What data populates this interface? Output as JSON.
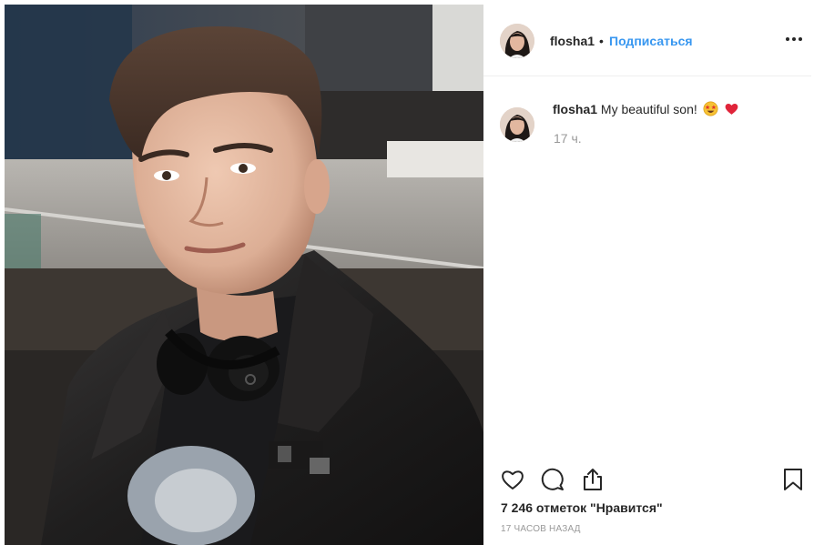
{
  "header": {
    "username": "flosha1",
    "separator": "•",
    "follow_label": "Подписаться",
    "more_icon": "more-horizontal-icon"
  },
  "caption": {
    "username": "flosha1",
    "text": "My beautiful son!",
    "emojis": [
      "star-struck-emoji",
      "red-heart-emoji"
    ],
    "time": "17 ч."
  },
  "actions": {
    "icons": [
      "heart-icon",
      "comment-icon",
      "share-icon",
      "bookmark-icon"
    ]
  },
  "likes_text": "7 246 отметок \"Нравится\"",
  "timestamp": "17 ЧАСОВ НАЗАД",
  "colors": {
    "link_blue": "#3897f0",
    "text": "#262626",
    "muted": "#999999",
    "divider": "#efefef"
  }
}
